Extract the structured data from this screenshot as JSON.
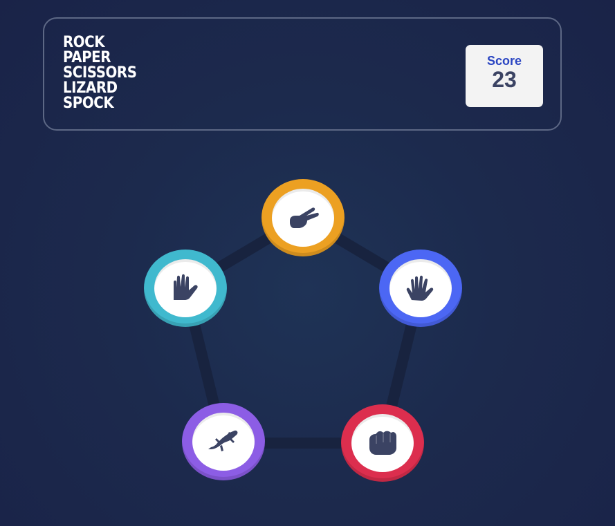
{
  "header": {
    "title_lines": [
      "ROCK",
      "PAPER",
      "SCISSORS",
      "LIZARD",
      "SPOCK"
    ],
    "score_label": "Score",
    "score_value": "23"
  },
  "tokens": [
    {
      "name": "scissors",
      "icon": "scissors-hand-icon",
      "color": "#eca022"
    },
    {
      "name": "spock",
      "icon": "spock-hand-icon",
      "color": "#40b9ce"
    },
    {
      "name": "paper",
      "icon": "paper-hand-icon",
      "color": "#4c67f4"
    },
    {
      "name": "lizard",
      "icon": "lizard-icon",
      "color": "#8c5de5"
    },
    {
      "name": "rock",
      "icon": "rock-fist-icon",
      "color": "#dc2e4e"
    }
  ],
  "colors": {
    "background": "#1e2b4f",
    "pentagon_line": "#18233f",
    "icon_fill": "#3b4363",
    "score_label": "#2a45c2"
  }
}
